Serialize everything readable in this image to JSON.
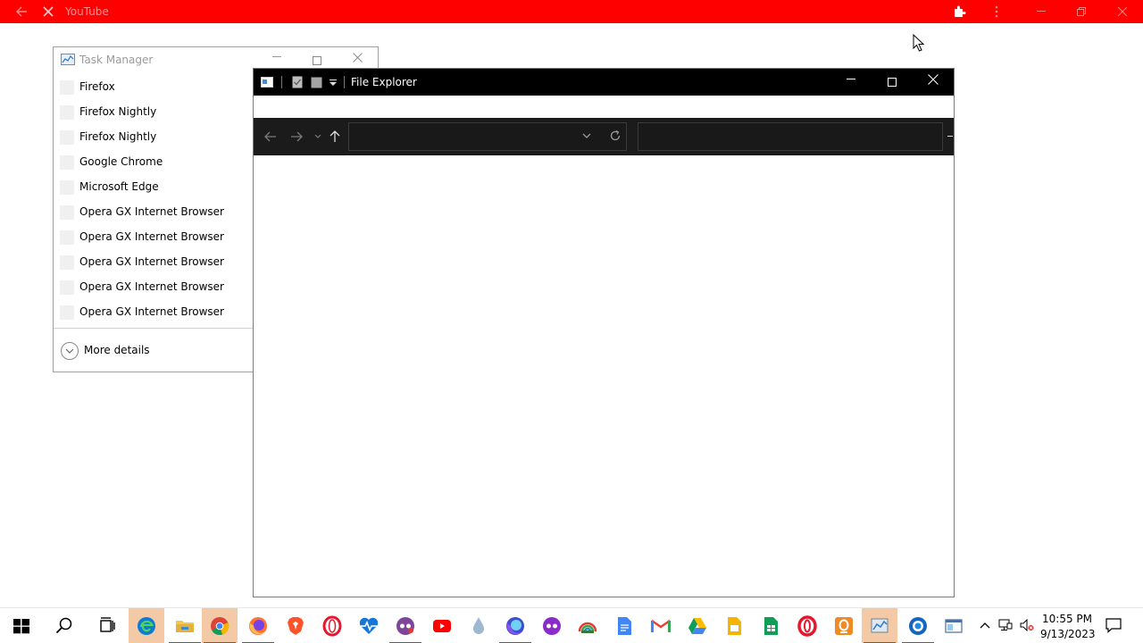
{
  "youtube_window": {
    "title": "YouTube",
    "accent_color": "#ff0000",
    "controls": {
      "minimize": "—",
      "restore": "❐",
      "close": "✕"
    }
  },
  "task_manager": {
    "title": "Task Manager",
    "apps": [
      {
        "name": "Firefox"
      },
      {
        "name": "Firefox Nightly"
      },
      {
        "name": "Firefox Nightly"
      },
      {
        "name": "Google Chrome"
      },
      {
        "name": "Microsoft Edge"
      },
      {
        "name": "Opera GX Internet Browser"
      },
      {
        "name": "Opera GX Internet Browser"
      },
      {
        "name": "Opera GX Internet Browser"
      },
      {
        "name": "Opera GX Internet Browser"
      },
      {
        "name": "Opera GX Internet Browser"
      }
    ],
    "more_details": "More details"
  },
  "file_explorer": {
    "title": "File Explorer",
    "address_value": "",
    "search_value": "",
    "theme": "dark"
  },
  "taskbar": {
    "clock": {
      "time": "10:55 PM",
      "date": "9/13/2023"
    },
    "apps": [
      {
        "icon": "windows-start-icon"
      },
      {
        "icon": "search-icon"
      },
      {
        "icon": "task-view-icon"
      },
      {
        "icon": "edge-icon"
      },
      {
        "icon": "file-explorer-icon"
      },
      {
        "icon": "chrome-icon"
      },
      {
        "icon": "firefox-icon"
      },
      {
        "icon": "brave-icon"
      },
      {
        "icon": "opera-icon"
      },
      {
        "icon": "health-monitor-icon"
      },
      {
        "icon": "tor-icon"
      },
      {
        "icon": "youtube-icon"
      },
      {
        "icon": "water-drop-icon"
      },
      {
        "icon": "firefox-nightly-icon"
      },
      {
        "icon": "mask-icon"
      },
      {
        "icon": "rainbow-app-icon"
      },
      {
        "icon": "google-docs-icon"
      },
      {
        "icon": "gmail-icon"
      },
      {
        "icon": "google-drive-icon"
      },
      {
        "icon": "google-slides-icon"
      },
      {
        "icon": "google-sheets-icon"
      },
      {
        "icon": "opera-icon"
      },
      {
        "icon": "opera-gx-hub-icon"
      },
      {
        "icon": "task-manager-icon"
      },
      {
        "icon": "shield-app-icon"
      },
      {
        "icon": "window-app-icon"
      }
    ]
  }
}
